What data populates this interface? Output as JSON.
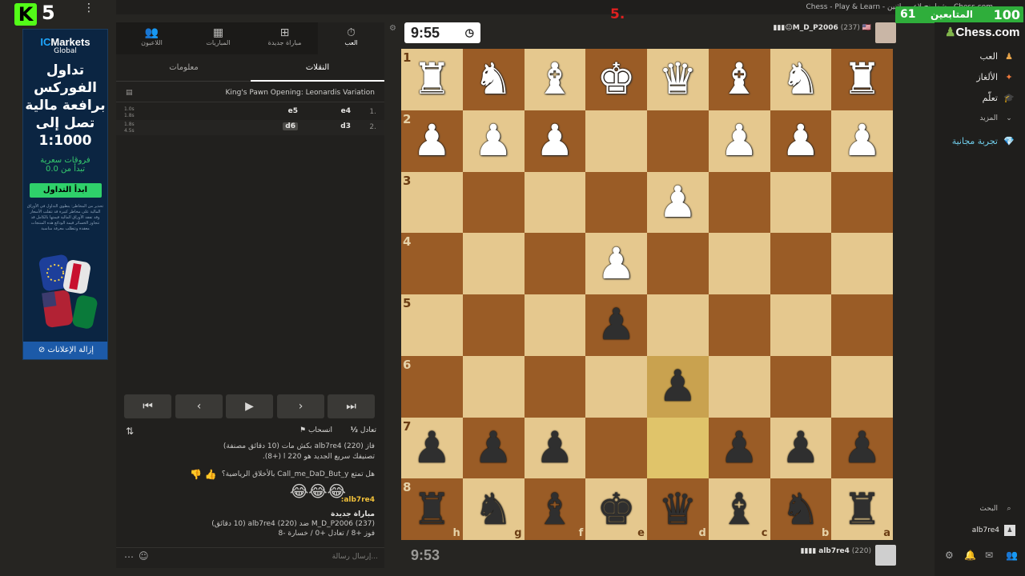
{
  "window": {
    "title": "Chess - Play & Learn - شطرنج لاعبين اثنين - Chess.com",
    "controls": "—  ▢  ✕"
  },
  "stream": {
    "k_logo": "K",
    "k_num": "5",
    "menu_dots": "⋮",
    "overlay_mark": "5.",
    "followers_label": "المتابعين",
    "followers_count": "61",
    "followers_goal": "100"
  },
  "ad": {
    "brand_a": "IC",
    "brand_b": "Markets",
    "brand_sub": "Global",
    "headline": "تداول الفوركس برافعة مالية تصل إلى 1:1000",
    "spread_line1": "فروقات سعرية",
    "spread_line2": "تبدأ من 0.0",
    "cta": "ابدأ التداول",
    "disclaimer": "تحذير من المخاطر: ينطوي التداول في الأوراق المالية على مخاطر كبيرة قد تتقلب الأسعار وقد تفقد الأوراق المالية قيمتها بالكامل قد تتجاوز الخسائر قيمة الودائع هذه المنتجات معقدة وتتطلب معرفة مناسبة",
    "remove": "إزالة الإعلانات"
  },
  "left_tabs": [
    {
      "label": "العب",
      "icon": "stopwatch-icon",
      "glyph": "⏱"
    },
    {
      "label": "مباراة جديدة",
      "icon": "plus-icon",
      "glyph": "⊞"
    },
    {
      "label": "المباريات",
      "icon": "board-icon",
      "glyph": "▦"
    },
    {
      "label": "اللاعبون",
      "icon": "users-icon",
      "glyph": "👥"
    }
  ],
  "sub_tabs": {
    "moves": "النقلات",
    "info": "معلومات"
  },
  "opening": "King's Pawn Opening: Leonardis Variation",
  "moves": [
    {
      "num": "1.",
      "white": "e4",
      "black": "e5",
      "t1": "1.0s",
      "t2": "1.8s"
    },
    {
      "num": "2.",
      "white": "d3",
      "black": "d6",
      "t1": "1.8s",
      "t2": "4.5s"
    }
  ],
  "nav": [
    "⏮",
    "‹",
    "▶",
    "›",
    "⏭"
  ],
  "actions": {
    "draw": "تعادل",
    "draw_icon": "½",
    "resign": "انسحاب",
    "resign_icon": "⚑",
    "rotate_icon": "⇅"
  },
  "chat": {
    "l1": "فاز alb7re4 (220) بكش مات (10 دقائق مصنفة)",
    "l2": "تصنيفك سريع الجديد هو 220 ا (+8).",
    "l3": "هل تمتع Call_me_DaD_But_y بالأخلاق الرياضية؟",
    "emoji": "😂😂😂",
    "user": "alb7re4:",
    "l5": "مباراة جديدة",
    "l6": "M_D_P2006 (237) ضد alb7re4 (220) (10 دقائق)",
    "l7": "فوز +8 / تعادل +0 / خسارة -8",
    "placeholder": "إرسال رسالة..."
  },
  "top_player": {
    "name": "M_D_P2006",
    "rating": "(237)",
    "flags": "🇺🇸😐▮▮▮",
    "clock": "9:55"
  },
  "bottom_player": {
    "name": "alb7re4",
    "rating": "(220)",
    "flags": "▮▮▮▮",
    "clock": "9:53"
  },
  "board": {
    "ranks": [
      "1",
      "2",
      "3",
      "4",
      "5",
      "6",
      "7",
      "8"
    ],
    "files": [
      "h",
      "g",
      "f",
      "e",
      "d",
      "c",
      "b",
      "a"
    ],
    "rows": [
      [
        "wR",
        "wN",
        "wB",
        "wK",
        "wQ",
        "wB",
        "wN",
        "wR"
      ],
      [
        "wP",
        "wP",
        "wP",
        "",
        "",
        "wP",
        "wP",
        "wP"
      ],
      [
        "",
        "",
        "",
        "",
        "wP",
        "",
        "",
        ""
      ],
      [
        "",
        "",
        "",
        "wP",
        "",
        "",
        "",
        ""
      ],
      [
        "",
        "",
        "",
        "bP",
        "",
        "",
        "",
        ""
      ],
      [
        "",
        "",
        "",
        "",
        "bP",
        "",
        "",
        ""
      ],
      [
        "bP",
        "bP",
        "bP",
        "",
        "",
        "bP",
        "bP",
        "bP"
      ],
      [
        "bR",
        "bN",
        "bB",
        "bK",
        "bQ",
        "bB",
        "bN",
        "bR"
      ]
    ],
    "highlight": [
      [
        5,
        4
      ],
      [
        6,
        4
      ]
    ]
  },
  "right_nav": [
    {
      "label": "العب",
      "glyph": "♟",
      "color": "#e8a44a"
    },
    {
      "label": "الألغاز",
      "glyph": "✦",
      "color": "#f07a3c"
    },
    {
      "label": "تعلّم",
      "glyph": "🎓",
      "color": "#4aa8e8"
    },
    {
      "label": "المزيد",
      "glyph": "⌄",
      "color": "#aaa"
    },
    {
      "label": "تجربة مجانية",
      "glyph": "💎",
      "color": "#55c8e8"
    }
  ],
  "brand": "Chess.com",
  "brand_pawn": "♟",
  "search": "البحث",
  "me": "alb7re4"
}
